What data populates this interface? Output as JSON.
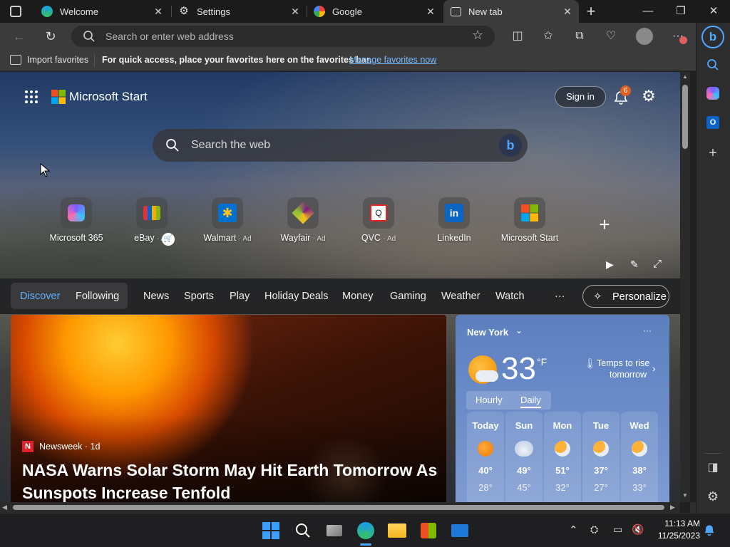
{
  "tabs": [
    {
      "label": "Welcome",
      "icon": "edge-icon"
    },
    {
      "label": "Settings",
      "icon": "gear-icon"
    },
    {
      "label": "Google",
      "icon": "google-icon"
    },
    {
      "label": "New tab",
      "icon": "newtab-icon"
    }
  ],
  "toolbar": {
    "address_placeholder": "Search or enter web address"
  },
  "favorites_bar": {
    "import_label": "Import favorites",
    "message": "For quick access, place your favorites here on the favorites bar.",
    "manage_link": "Manage favorites now"
  },
  "header": {
    "brand": "Microsoft Start",
    "sign_in": "Sign in",
    "notification_count": "6"
  },
  "search": {
    "placeholder": "Search the web"
  },
  "quick_links": [
    {
      "label": "Microsoft 365",
      "ad": ""
    },
    {
      "label": "eBay",
      "ad": "· Ad"
    },
    {
      "label": "Walmart",
      "ad": "· Ad"
    },
    {
      "label": "Wayfair",
      "ad": "· Ad"
    },
    {
      "label": "QVC",
      "ad": "· Ad"
    },
    {
      "label": "LinkedIn",
      "ad": ""
    },
    {
      "label": "Microsoft Start",
      "ad": ""
    }
  ],
  "nav": {
    "discover": "Discover",
    "following": "Following",
    "items": [
      "News",
      "Sports",
      "Play",
      "Holiday Deals",
      "Money",
      "Gaming",
      "Weather",
      "Watch"
    ],
    "more": "···",
    "personalize": "Personalize"
  },
  "article": {
    "source": "Newsweek · 1d",
    "headline_line1": "NASA Warns Solar Storm May Hit Earth Tomorrow As",
    "headline_line2": "Sunspots Increase Tenfold"
  },
  "weather": {
    "city": "New York",
    "temp": "33",
    "unit": "°F",
    "note_line1": "Temps to rise",
    "note_line2": "tomorrow",
    "tab_hourly": "Hourly",
    "tab_daily": "Daily",
    "more": "···",
    "days": [
      {
        "name": "Today",
        "hi": "40°",
        "lo": "28°",
        "icon": "sun-icon"
      },
      {
        "name": "Sun",
        "hi": "49°",
        "lo": "45°",
        "icon": "cloud-icon"
      },
      {
        "name": "Mon",
        "hi": "51°",
        "lo": "32°",
        "icon": "partly-cloudy-icon"
      },
      {
        "name": "Tue",
        "hi": "37°",
        "lo": "27°",
        "icon": "partly-cloudy-icon"
      },
      {
        "name": "Wed",
        "hi": "38°",
        "lo": "33°",
        "icon": "partly-cloudy-icon"
      }
    ]
  },
  "taskbar": {
    "time": "11:13 AM",
    "date": "11/25/2023"
  },
  "colors": {
    "accent": "#4fa8ff",
    "link": "#78b9ff",
    "badge": "#e06020"
  }
}
